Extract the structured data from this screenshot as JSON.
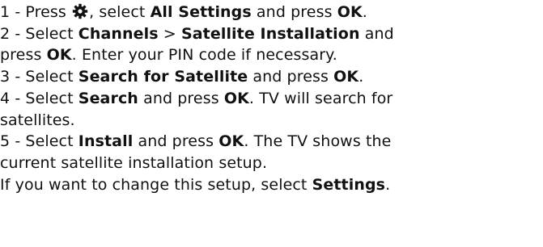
{
  "steps": [
    {
      "prefix": "1 -  Press ",
      "icon": "gear-icon",
      "mid1": ", select ",
      "kw1": "All Settings",
      "mid2": " and press ",
      "kw2": "OK",
      "end": "."
    },
    {
      "prefix": "2 -  Select ",
      "kw1": "Channels",
      "mid1": " > ",
      "kw2": "Satellite Installation",
      "end": " and"
    },
    {
      "prefix": "press ",
      "kw1": "OK",
      "end": ". Enter your PIN code if necessary."
    },
    {
      "prefix": "3 -  Select ",
      "kw1": "Search for Satellite",
      "mid1": " and press ",
      "kw2": "OK",
      "end": "."
    },
    {
      "prefix": "4 -  Select ",
      "kw1": "Search",
      "mid1": " and press ",
      "kw2": "OK",
      "end": ". TV will search for"
    },
    {
      "text": "satellites."
    },
    {
      "prefix": "5 -  Select ",
      "kw1": "Install",
      "mid1": " and press ",
      "kw2": "OK",
      "end": ". The TV shows the"
    },
    {
      "text": "current satellite installation setup."
    },
    {
      "prefix": "If you want to change this setup, select ",
      "kw1": "Settings",
      "end": "."
    }
  ]
}
